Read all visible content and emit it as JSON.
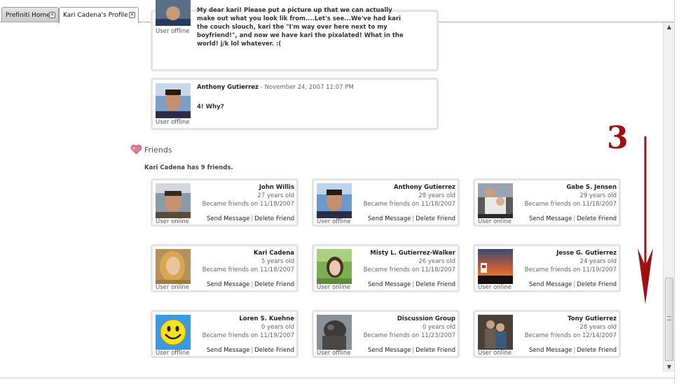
{
  "tabs": [
    {
      "label": "Prefiniti Home",
      "active": false
    },
    {
      "label": "Kari Cadena's Profile",
      "active": true
    }
  ],
  "comments": [
    {
      "author": "",
      "date": "",
      "status": "User offline",
      "body": "My dear kari!  Please put a picture up that we can actually make out what you look lik from....Let's see...We've had kari the couch slouch, kari the \"I'm way over here next to my boyfriend!\", and now we have kari the pixalated!  What in the world! j/k lol whatever. :("
    },
    {
      "author": "Anthony Gutierrez",
      "date": "- November 24, 2007 11:07 PM",
      "status": "User offline",
      "body": "4! Why?"
    }
  ],
  "friends": {
    "title": "Friends",
    "count_text": "Kari Cadena has 9 friends.",
    "send_label": "Send Message",
    "delete_label": "Delete Friend",
    "list": [
      {
        "name": "John Willis",
        "age": "27 years old",
        "since": "Became friends on 11/18/2007",
        "status": "User online",
        "avatar": "face-man"
      },
      {
        "name": "Anthony Gutierrez",
        "age": "28 years old",
        "since": "Became friends on 11/18/2007",
        "status": "User offline",
        "avatar": "face-man2"
      },
      {
        "name": "Gabe S. Jensen",
        "age": "29 years old",
        "since": "Became friends on 11/18/2007",
        "status": "User online",
        "avatar": "family"
      },
      {
        "name": "Kari Cadena",
        "age": "5 years old",
        "since": "Became friends on 11/18/2007",
        "status": "User online",
        "avatar": "face-woman"
      },
      {
        "name": "Misty L. Gutierrez-Walker",
        "age": "26 years old",
        "since": "Became friends on 11/18/2007",
        "status": "User online",
        "avatar": "face-woman2"
      },
      {
        "name": "Jesse G. Gutierrez",
        "age": "24 years old",
        "since": "Became friends on 11/19/2007",
        "status": "User online",
        "avatar": "sunset"
      },
      {
        "name": "Loren S. Kuehne",
        "age": "0 years old",
        "since": "Became friends on 11/19/2007",
        "status": "User offline",
        "avatar": "smiley"
      },
      {
        "name": "Discussion Group",
        "age": "0 years old",
        "since": "Became friends on 11/23/2007",
        "status": "User offline",
        "avatar": "statue"
      },
      {
        "name": "Tony Gutierrez",
        "age": "28 years old",
        "since": "Became friends on 12/14/2007",
        "status": "User online",
        "avatar": "couple"
      }
    ]
  },
  "annotation": {
    "number": "3",
    "color": "#a01010"
  },
  "colors": {
    "card_border": "#e4e4e4",
    "heart": "#e0607a"
  }
}
